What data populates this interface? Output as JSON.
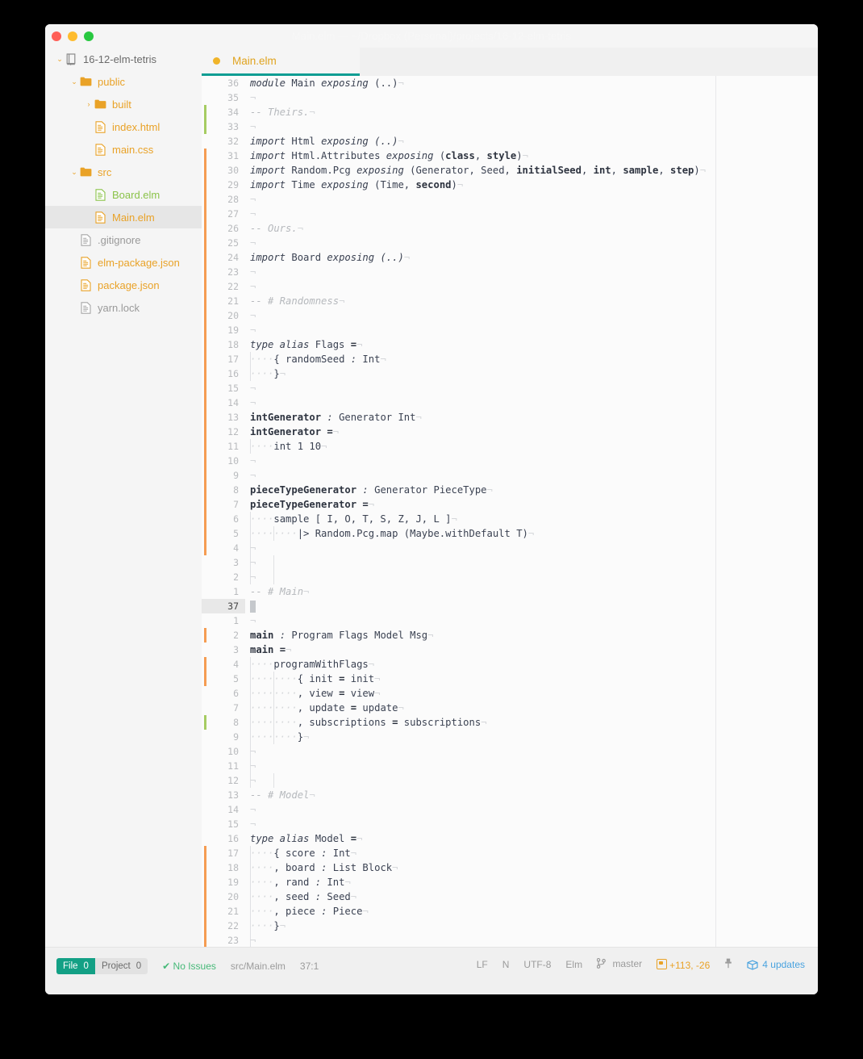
{
  "window": {
    "title": "Main.elm — ~/Dropbox (Personal)/projects/16-12-elm-tetris",
    "lights": [
      {
        "name": "close",
        "color": "#ff5f57"
      },
      {
        "name": "minimize",
        "color": "#febc2e"
      },
      {
        "name": "zoom",
        "color": "#28c840"
      }
    ]
  },
  "tree": {
    "items": [
      {
        "label": "16-12-elm-tetris",
        "depth": 0,
        "chev": "⌄",
        "icon": "book-icon",
        "color": "c-proj",
        "selected": false
      },
      {
        "label": "public",
        "depth": 1,
        "chev": "⌄",
        "icon": "folder-icon",
        "color": "c-y",
        "selected": false
      },
      {
        "label": "built",
        "depth": 2,
        "chev": "›",
        "icon": "folder-icon",
        "color": "c-y",
        "selected": false
      },
      {
        "label": "index.html",
        "depth": 2,
        "chev": "",
        "icon": "file-icon",
        "color": "c-y",
        "selected": false
      },
      {
        "label": "main.css",
        "depth": 2,
        "chev": "",
        "icon": "file-icon",
        "color": "c-y",
        "selected": false
      },
      {
        "label": "src",
        "depth": 1,
        "chev": "⌄",
        "icon": "folder-icon",
        "color": "c-y",
        "selected": false
      },
      {
        "label": "Board.elm",
        "depth": 2,
        "chev": "",
        "icon": "file-icon",
        "color": "c-g",
        "selected": false
      },
      {
        "label": "Main.elm",
        "depth": 2,
        "chev": "",
        "icon": "file-icon",
        "color": "c-y",
        "selected": true
      },
      {
        "label": ".gitignore",
        "depth": 1,
        "chev": "",
        "icon": "file-icon",
        "color": "c-gray",
        "selected": false
      },
      {
        "label": "elm-package.json",
        "depth": 1,
        "chev": "",
        "icon": "file-icon",
        "color": "c-y",
        "selected": false
      },
      {
        "label": "package.json",
        "depth": 1,
        "chev": "",
        "icon": "file-icon",
        "color": "c-y",
        "selected": false
      },
      {
        "label": "yarn.lock",
        "depth": 1,
        "chev": "",
        "icon": "file-icon",
        "color": "c-gray",
        "selected": false
      }
    ]
  },
  "tabs": [
    {
      "label": "Main.elm",
      "modified": true,
      "active": true
    }
  ],
  "editor": {
    "caret_line_number": "37",
    "lines": [
      {
        "n": "36",
        "mark": "",
        "html": "<i class='kw'>module</i> Main <i class='kw'>exposing</i> (..)<i class='inv'>¬</i>"
      },
      {
        "n": "35",
        "mark": "",
        "html": "<i class='inv'>¬</i>"
      },
      {
        "n": "34",
        "mark": "add",
        "html": "<i class='cm'>-- Theirs.</i><i class='inv'>¬</i>"
      },
      {
        "n": "33",
        "mark": "add",
        "html": "<i class='inv'>¬</i>"
      },
      {
        "n": "32",
        "mark": "",
        "html": "<i class='kw'>import</i> Html <i class='kw'>exposing</i> <i class='kw'>(..)</i><i class='inv'>¬</i>"
      },
      {
        "n": "31",
        "mark": "mod",
        "html": "<i class='kw'>import</i> Html.Attributes <i class='kw'>exposing</i> (<b class='bold'>class</b>, <b class='bold'>style</b>)<i class='inv'>¬</i>"
      },
      {
        "n": "30",
        "mark": "mod",
        "html": "<i class='kw'>import</i> Random.Pcg <i class='kw'>exposing</i> (Generator, Seed, <b class='bold'>initialSeed</b>, <b class='bold'>int</b>, <b class='bold'>sample</b>, <b class='bold'>step</b>)<i class='inv'>¬</i>"
      },
      {
        "n": "29",
        "mark": "mod",
        "html": "<i class='kw'>import</i> Time <i class='kw'>exposing</i> (Time, <b class='bold'>second</b>)<i class='inv'>¬</i>"
      },
      {
        "n": "28",
        "mark": "mod",
        "html": "<i class='inv'>¬</i>"
      },
      {
        "n": "27",
        "mark": "mod",
        "html": "<i class='inv'>¬</i>"
      },
      {
        "n": "26",
        "mark": "mod",
        "html": "<i class='cm'>-- Ours.</i><i class='inv'>¬</i>"
      },
      {
        "n": "25",
        "mark": "mod",
        "html": "<i class='inv'>¬</i>"
      },
      {
        "n": "24",
        "mark": "mod",
        "html": "<i class='kw'>import</i> Board <i class='kw'>exposing</i> <i class='kw'>(..)</i><i class='inv'>¬</i>"
      },
      {
        "n": "23",
        "mark": "mod",
        "html": "<i class='inv'>¬</i>"
      },
      {
        "n": "22",
        "mark": "mod",
        "html": "<i class='inv'>¬</i>"
      },
      {
        "n": "21",
        "mark": "mod",
        "html": "<i class='cm'>-- # Randomness</i><i class='inv'>¬</i>"
      },
      {
        "n": "20",
        "mark": "mod",
        "html": "<i class='inv'>¬</i>"
      },
      {
        "n": "19",
        "mark": "mod",
        "html": "<i class='inv'>¬</i>"
      },
      {
        "n": "18",
        "mark": "mod",
        "html": "<i class='kw'>type alias</i> Flags <b class='bold'>=</b><i class='inv'>¬</i>"
      },
      {
        "n": "17",
        "mark": "mod",
        "guides": [
          0
        ],
        "html": "<i class='ind'>····</i>{ randomSeed <i class='kw'>:</i> Int<i class='inv'>¬</i>"
      },
      {
        "n": "16",
        "mark": "mod",
        "guides": [
          0
        ],
        "html": "<i class='ind'>····</i>}<i class='inv'>¬</i>"
      },
      {
        "n": "15",
        "mark": "mod",
        "html": "<i class='inv'>¬</i>"
      },
      {
        "n": "14",
        "mark": "mod",
        "html": "<i class='inv'>¬</i>"
      },
      {
        "n": "13",
        "mark": "mod",
        "html": "<b class='bold'>intGenerator</b> <i class='kw'>:</i> Generator Int<i class='inv'>¬</i>"
      },
      {
        "n": "12",
        "mark": "mod",
        "html": "<b class='bold'>intGenerator</b> <b class='bold'>=</b><i class='inv'>¬</i>"
      },
      {
        "n": "11",
        "mark": "mod",
        "guides": [
          0
        ],
        "html": "<i class='ind'>····</i>int 1 10<i class='inv'>¬</i>"
      },
      {
        "n": "10",
        "mark": "mod",
        "html": "<i class='inv'>¬</i>"
      },
      {
        "n": "9",
        "mark": "mod",
        "html": "<i class='inv'>¬</i>"
      },
      {
        "n": "8",
        "mark": "mod",
        "html": "<b class='bold'>pieceTypeGenerator</b> <i class='kw'>:</i> Generator PieceType<i class='inv'>¬</i>"
      },
      {
        "n": "7",
        "mark": "mod",
        "html": "<b class='bold'>pieceTypeGenerator</b> <b class='bold'>=</b><i class='inv'>¬</i>"
      },
      {
        "n": "6",
        "mark": "mod",
        "guides": [
          0
        ],
        "html": "<i class='ind'>····</i>sample [ I, O, T, S, Z, J, L ]<i class='inv'>¬</i>"
      },
      {
        "n": "5",
        "mark": "mod",
        "guides": [
          0,
          4
        ],
        "html": "<i class='ind'>········</i>|&gt; Random.Pcg.map (Maybe.withDefault T)<i class='inv'>¬</i>"
      },
      {
        "n": "4",
        "mark": "mod",
        "guides": [
          0
        ],
        "html": "<i class='inv'>¬</i>"
      },
      {
        "n": "3",
        "mark": "",
        "guides": [
          0,
          4
        ],
        "html": "<i class='inv'>¬</i>"
      },
      {
        "n": "2",
        "mark": "",
        "guides": [
          0,
          4
        ],
        "html": "<i class='inv'>¬</i>"
      },
      {
        "n": "1",
        "mark": "",
        "html": "<i class='cm'>-- # Main</i><i class='inv'>¬</i>"
      },
      {
        "n": "37",
        "mark": "",
        "current": true,
        "html": ""
      },
      {
        "n": "1",
        "mark": "",
        "html": "<i class='inv'>¬</i>"
      },
      {
        "n": "2",
        "mark": "mod",
        "html": "<b class='bold'>main</b> <i class='kw'>:</i> Program Flags Model Msg<i class='inv'>¬</i>"
      },
      {
        "n": "3",
        "mark": "",
        "html": "<b class='bold'>main</b> <b class='bold'>=</b><i class='inv'>¬</i>"
      },
      {
        "n": "4",
        "mark": "mod",
        "guides": [
          0
        ],
        "html": "<i class='ind'>····</i>programWithFlags<i class='inv'>¬</i>"
      },
      {
        "n": "5",
        "mark": "mod",
        "guides": [
          0,
          4
        ],
        "html": "<i class='ind'>········</i>{ init <b class='bold'>=</b> init<i class='inv'>¬</i>"
      },
      {
        "n": "6",
        "mark": "",
        "guides": [
          0,
          4
        ],
        "html": "<i class='ind'>········</i>, view <b class='bold'>=</b> view<i class='inv'>¬</i>"
      },
      {
        "n": "7",
        "mark": "",
        "guides": [
          0,
          4
        ],
        "html": "<i class='ind'>········</i>, update <b class='bold'>=</b> update<i class='inv'>¬</i>"
      },
      {
        "n": "8",
        "mark": "add",
        "guides": [
          0,
          4
        ],
        "html": "<i class='ind'>········</i>, subscriptions <b class='bold'>=</b> subscriptions<i class='inv'>¬</i>"
      },
      {
        "n": "9",
        "mark": "",
        "guides": [
          0,
          4
        ],
        "html": "<i class='ind'>········</i>}<i class='inv'>¬</i>"
      },
      {
        "n": "10",
        "mark": "",
        "guides": [
          0
        ],
        "html": "<i class='inv'>¬</i>"
      },
      {
        "n": "11",
        "mark": "",
        "guides": [
          0
        ],
        "html": "<i class='inv'>¬</i>"
      },
      {
        "n": "12",
        "mark": "",
        "guides": [
          0,
          4
        ],
        "html": "<i class='inv'>¬</i>"
      },
      {
        "n": "13",
        "mark": "",
        "html": "<i class='cm'>-- # Model</i><i class='inv'>¬</i>"
      },
      {
        "n": "14",
        "mark": "",
        "html": "<i class='inv'>¬</i>"
      },
      {
        "n": "15",
        "mark": "",
        "html": "<i class='inv'>¬</i>"
      },
      {
        "n": "16",
        "mark": "",
        "html": "<i class='kw'>type alias</i> Model <b class='bold'>=</b><i class='inv'>¬</i>"
      },
      {
        "n": "17",
        "mark": "mod",
        "guides": [
          0
        ],
        "html": "<i class='ind'>····</i>{ score <i class='kw'>:</i> Int<i class='inv'>¬</i>"
      },
      {
        "n": "18",
        "mark": "mod",
        "guides": [
          0
        ],
        "html": "<i class='ind'>····</i>, board <i class='kw'>:</i> List Block<i class='inv'>¬</i>"
      },
      {
        "n": "19",
        "mark": "mod",
        "guides": [
          0
        ],
        "html": "<i class='ind'>····</i>, rand <i class='kw'>:</i> Int<i class='inv'>¬</i>"
      },
      {
        "n": "20",
        "mark": "mod",
        "guides": [
          0
        ],
        "html": "<i class='ind'>····</i>, seed <i class='kw'>:</i> Seed<i class='inv'>¬</i>"
      },
      {
        "n": "21",
        "mark": "mod",
        "guides": [
          0
        ],
        "html": "<i class='ind'>····</i>, piece <i class='kw'>:</i> Piece<i class='inv'>¬</i>"
      },
      {
        "n": "22",
        "mark": "mod",
        "guides": [
          0
        ],
        "html": "<i class='ind'>····</i>}<i class='inv'>¬</i>"
      },
      {
        "n": "23",
        "mark": "mod",
        "guides": [
          0
        ],
        "html": "<i class='inv'>¬</i>"
      }
    ]
  },
  "statusbar": {
    "file_label": "File",
    "file_count": "0",
    "project_label": "Project",
    "project_count": "0",
    "issues": "No Issues",
    "path": "src/Main.elm",
    "cursor": "37:1",
    "line_ending": "LF",
    "indent": "N",
    "encoding": "UTF-8",
    "grammar": "Elm",
    "branch": "master",
    "diff": "+113, -26",
    "updates": "4 updates"
  },
  "colors": {
    "accent_teal": "#0f9d93",
    "accent_yellow": "#e9a227",
    "added_green": "#a6cc62",
    "modified_orange": "#f59c52",
    "ok_green": "#46b978",
    "link_blue": "#4aa3df"
  }
}
